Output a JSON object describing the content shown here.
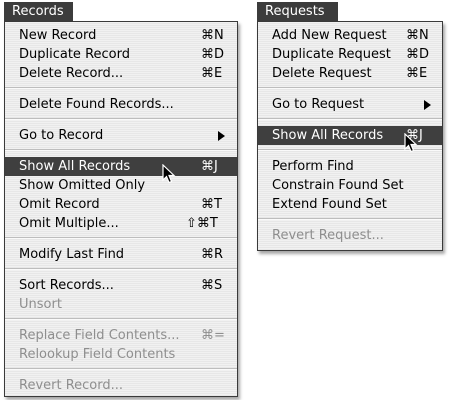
{
  "records_menu": {
    "title": "Records",
    "items": [
      {
        "label": "New Record",
        "shortcut": "⌘N",
        "enabled": true
      },
      {
        "label": "Duplicate Record",
        "shortcut": "⌘D",
        "enabled": true
      },
      {
        "label": "Delete Record...",
        "shortcut": "⌘E",
        "enabled": true
      },
      {
        "label": "Delete Found Records...",
        "shortcut": "",
        "enabled": true
      },
      {
        "label": "Go to Record",
        "shortcut": "",
        "enabled": true,
        "submenu": true
      },
      {
        "label": "Show All Records",
        "shortcut": "⌘J",
        "enabled": true,
        "selected": true
      },
      {
        "label": "Show Omitted Only",
        "shortcut": "",
        "enabled": true
      },
      {
        "label": "Omit Record",
        "shortcut": "⌘T",
        "enabled": true
      },
      {
        "label": "Omit Multiple...",
        "shortcut": "⇧⌘T",
        "enabled": true
      },
      {
        "label": "Modify Last Find",
        "shortcut": "⌘R",
        "enabled": true
      },
      {
        "label": "Sort Records...",
        "shortcut": "⌘S",
        "enabled": true
      },
      {
        "label": "Unsort",
        "shortcut": "",
        "enabled": false
      },
      {
        "label": "Replace Field Contents...",
        "shortcut": "⌘=",
        "enabled": false
      },
      {
        "label": "Relookup Field Contents",
        "shortcut": "",
        "enabled": false
      },
      {
        "label": "Revert Record...",
        "shortcut": "",
        "enabled": false
      }
    ]
  },
  "requests_menu": {
    "title": "Requests",
    "items": [
      {
        "label": "Add New Request",
        "shortcut": "⌘N",
        "enabled": true
      },
      {
        "label": "Duplicate Request",
        "shortcut": "⌘D",
        "enabled": true
      },
      {
        "label": "Delete Request",
        "shortcut": "⌘E",
        "enabled": true
      },
      {
        "label": "Go to Request",
        "shortcut": "",
        "enabled": true,
        "submenu": true
      },
      {
        "label": "Show All Records",
        "shortcut": "⌘J",
        "enabled": true,
        "selected": true
      },
      {
        "label": "Perform Find",
        "shortcut": "",
        "enabled": true
      },
      {
        "label": "Constrain Found Set",
        "shortcut": "",
        "enabled": true
      },
      {
        "label": "Extend Found Set",
        "shortcut": "",
        "enabled": true
      },
      {
        "label": "Revert Request...",
        "shortcut": "",
        "enabled": false
      }
    ]
  },
  "cursor": {
    "icon": "arrow-pointer-icon"
  },
  "colors": {
    "selected_bg": "#3f3f3f",
    "title_bg": "#3c3c3c",
    "disabled_text": "#8e8e8e"
  }
}
